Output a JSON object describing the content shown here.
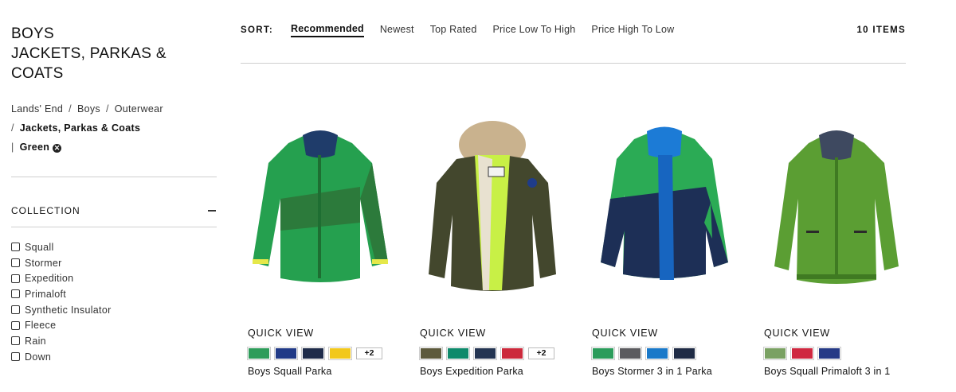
{
  "sidebar": {
    "title_lines": [
      "BOYS",
      "JACKETS, PARKAS &",
      "COATS"
    ],
    "breadcrumb": {
      "items": [
        "Lands' End",
        "Boys",
        "Outerwear"
      ],
      "separator": "/",
      "current": "Jackets, Parkas & Coats",
      "filter_separator": "|",
      "active_filter": "Green",
      "remove_glyph": "✕"
    },
    "facet": {
      "title": "COLLECTION",
      "options": [
        "Squall",
        "Stormer",
        "Expedition",
        "Primaloft",
        "Synthetic Insulator",
        "Fleece",
        "Rain",
        "Down"
      ]
    }
  },
  "sort": {
    "label": "SORT:",
    "options": [
      "Recommended",
      "Newest",
      "Top Rated",
      "Price Low To High",
      "Price High To Low"
    ],
    "active": "Recommended",
    "item_count": "10 ITEMS"
  },
  "products": [
    {
      "name": "Boys Squall Parka",
      "quick_view": "QUICK VIEW",
      "swatches": [
        "#2e9c5a",
        "#213a87",
        "#1f2c4a",
        "#f2c81c"
      ],
      "more": "+2",
      "image_icon": "green-parka-image"
    },
    {
      "name": "Boys Expedition Parka",
      "quick_view": "QUICK VIEW",
      "swatches": [
        "#5d5a3c",
        "#0e8a6b",
        "#243552",
        "#cc2a3c"
      ],
      "more": "+2",
      "image_icon": "olive-fur-hood-parka-image"
    },
    {
      "name": "Boys Stormer 3 in 1 Parka",
      "quick_view": "QUICK VIEW",
      "swatches": [
        "#2b9c5b",
        "#5b5b5f",
        "#1a79c9",
        "#1f2b45"
      ],
      "more": "",
      "image_icon": "green-navy-3in1-parka-image"
    },
    {
      "name": "Boys Squall Primaloft 3 in 1",
      "quick_view": "QUICK VIEW",
      "swatches": [
        "#7aa163",
        "#cf2840",
        "#263a86"
      ],
      "more": "",
      "image_icon": "green-primaloft-parka-image"
    }
  ]
}
